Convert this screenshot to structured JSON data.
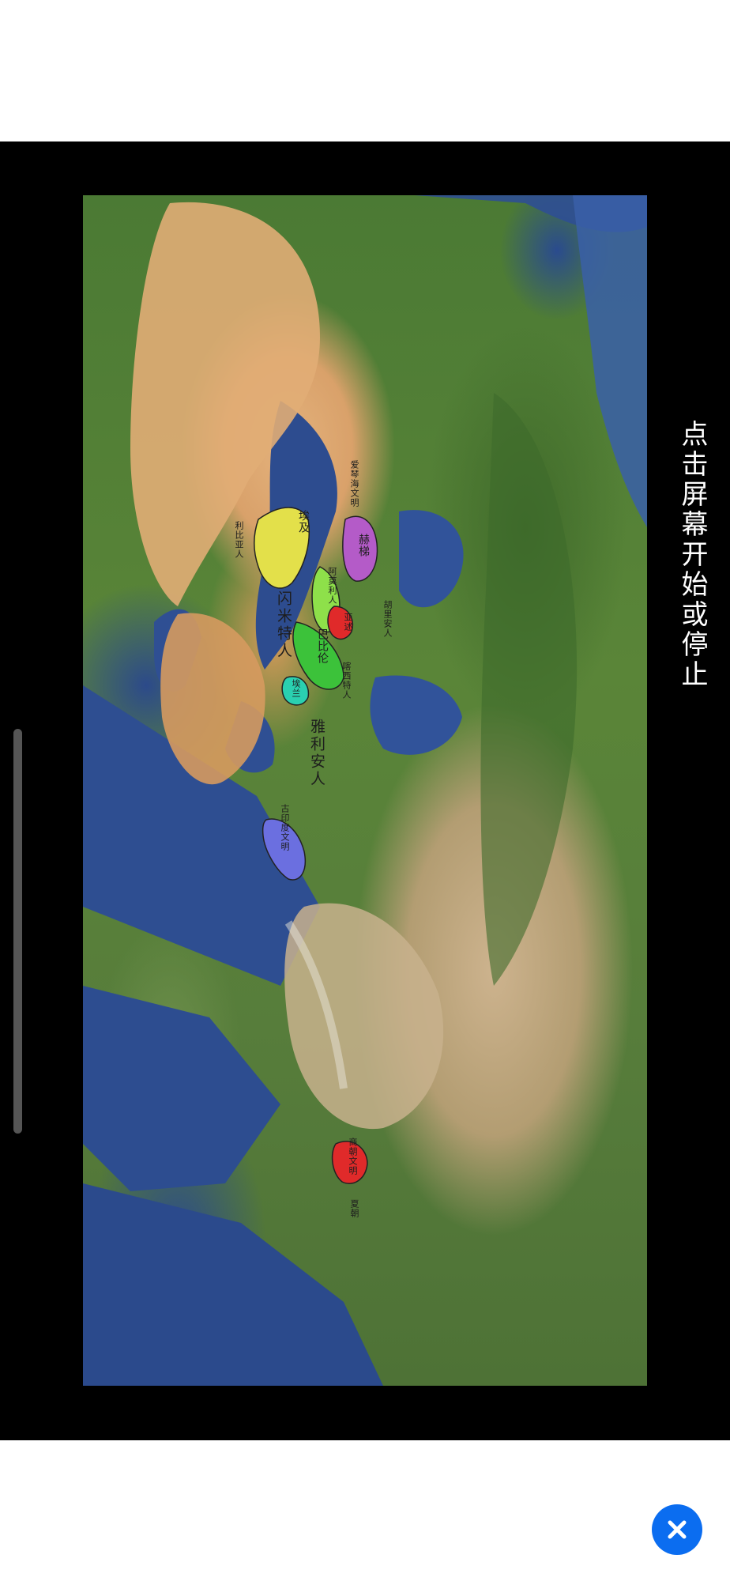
{
  "player": {
    "tap_hint": "点击屏幕开始或停止",
    "close_icon": "close-icon"
  },
  "map": {
    "labels": {
      "hittites": "赫梯",
      "aegean": "爱琴海文明",
      "libyans": "利比亚人",
      "semites_near": "闪米特人",
      "arameans": "阿莫利人",
      "hurrians": "胡里安人",
      "assyria": "亚述",
      "babylon": "巴比伦",
      "kassites": "喀西特人",
      "elam": "埃兰",
      "semites": "闪米特人",
      "indo_iranians": "雅利安人",
      "indus": "古印度文明",
      "shang": "商朝文明",
      "xia": "夏朝",
      "egypt": "埃及"
    },
    "region_colors": {
      "egypt": "#e3e04a",
      "hittites": "#b45bc8",
      "assyria": "#e02a2a",
      "mesopotamia": "#3cc23a",
      "levant": "#8ee04a",
      "elam": "#2ad0b0",
      "indus": "#6b6fe0",
      "shang": "#e02a2a"
    }
  }
}
